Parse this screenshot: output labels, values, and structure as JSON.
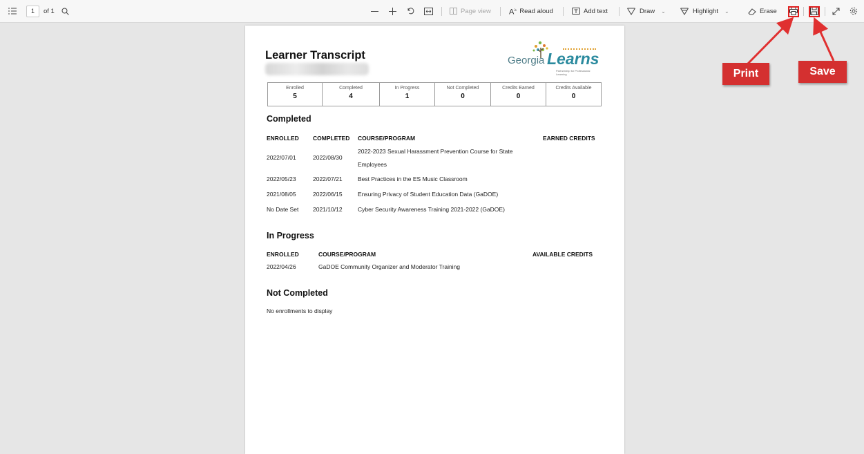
{
  "toolbar": {
    "page_number": "1",
    "page_of": "of 1",
    "page_view": "Page view",
    "read_aloud": "Read aloud",
    "add_text": "Add text",
    "draw": "Draw",
    "highlight": "Highlight",
    "erase": "Erase",
    "icons": [
      "contents-icon",
      "search-icon",
      "zoom-out-icon",
      "zoom-in-icon",
      "rotate-icon",
      "fit-page-icon",
      "page-view-icon",
      "read-aloud-icon",
      "add-text-icon",
      "draw-icon",
      "highlight-icon",
      "erase-icon",
      "print-icon",
      "save-icon",
      "fullscreen-icon",
      "settings-icon"
    ]
  },
  "callouts": {
    "print": "Print",
    "save": "Save",
    "color": "#d43030"
  },
  "document": {
    "title": "Learner Transcript",
    "logo": {
      "georgia": "Georgia",
      "learns": "Learns",
      "tagline": "Partnership for Professional Learning"
    },
    "stats": [
      {
        "label": "Enrolled",
        "value": "5"
      },
      {
        "label": "Completed",
        "value": "4"
      },
      {
        "label": "In Progress",
        "value": "1"
      },
      {
        "label": "Not Completed",
        "value": "0"
      },
      {
        "label": "Credits Earned",
        "value": "0"
      },
      {
        "label": "Credits Available",
        "value": "0"
      }
    ],
    "completed": {
      "heading": "Completed",
      "columns": [
        "ENROLLED",
        "COMPLETED",
        "COURSE/PROGRAM",
        "EARNED CREDITS"
      ],
      "rows": [
        {
          "enrolled": "2022/07/01",
          "completed": "2022/08/30",
          "course_line1": "2022-2023 Sexual Harassment Prevention Course for State",
          "course_line2": "Employees"
        },
        {
          "enrolled": "2022/05/23",
          "completed": "2022/07/21",
          "course_line1": "Best Practices in the ES Music Classroom"
        },
        {
          "enrolled": "2021/08/05",
          "completed": "2022/06/15",
          "course_line1": "Ensuring Privacy of Student Education Data (GaDOE)"
        },
        {
          "enrolled": "No Date Set",
          "completed": "2021/10/12",
          "course_line1": "Cyber Security Awareness Training 2021-2022 (GaDOE)"
        }
      ]
    },
    "in_progress": {
      "heading": "In Progress",
      "columns": [
        "ENROLLED",
        "COURSE/PROGRAM",
        "AVAILABLE CREDITS"
      ],
      "rows": [
        {
          "enrolled": "2022/04/26",
          "course": "GaDOE Community Organizer and Moderator Training"
        }
      ]
    },
    "not_completed": {
      "heading": "Not Completed",
      "empty_text": "No enrollments to display"
    }
  }
}
